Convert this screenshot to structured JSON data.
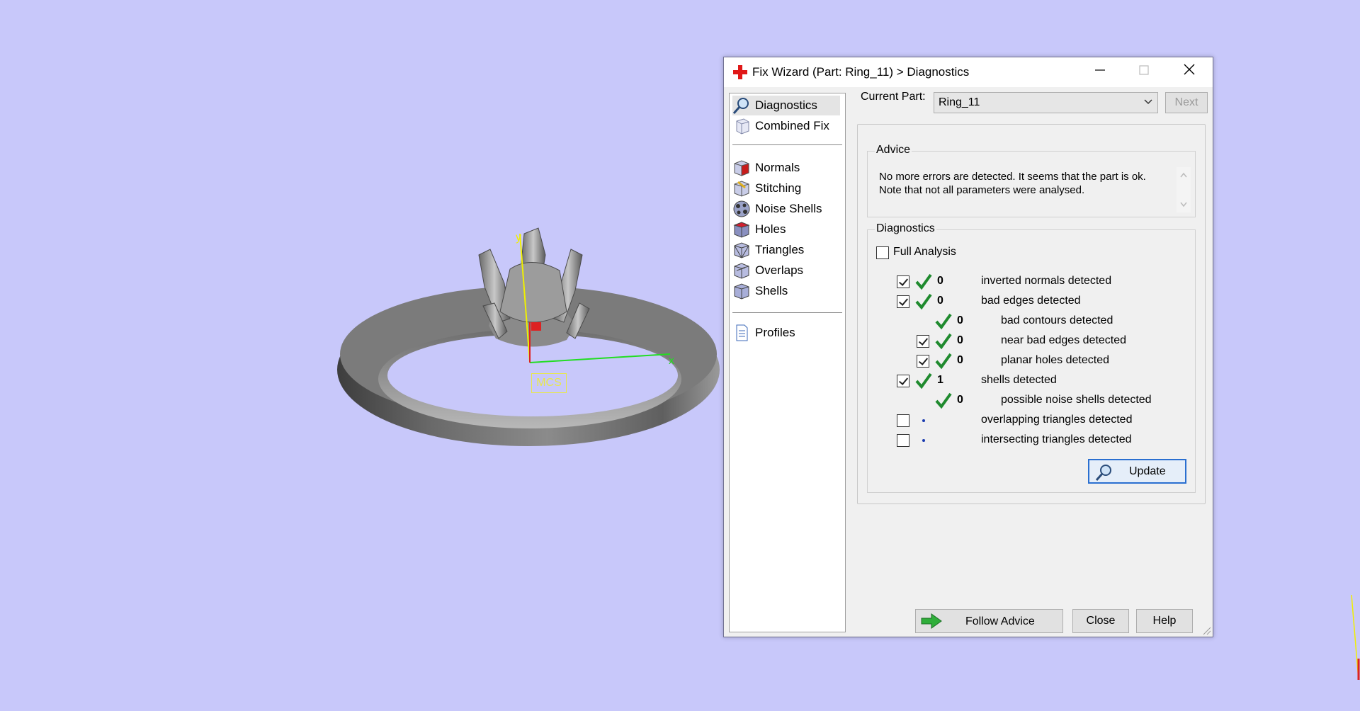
{
  "viewport": {
    "axis_y": "y",
    "axis_x": "x",
    "mcs_label": "MCS"
  },
  "dialog": {
    "title": "Fix Wizard (Part: Ring_11) > Diagnostics",
    "nav": [
      {
        "label": "Diagnostics",
        "icon": "magnifier-icon"
      },
      {
        "label": "Combined Fix",
        "icon": "combined-fix-icon"
      },
      {
        "label": "Normals",
        "icon": "normals-cube-icon"
      },
      {
        "label": "Stitching",
        "icon": "stitching-cube-icon"
      },
      {
        "label": "Noise Shells",
        "icon": "noise-shells-icon"
      },
      {
        "label": "Holes",
        "icon": "holes-cube-icon"
      },
      {
        "label": "Triangles",
        "icon": "triangles-cube-icon"
      },
      {
        "label": "Overlaps",
        "icon": "overlaps-cube-icon"
      },
      {
        "label": "Shells",
        "icon": "shells-cube-icon"
      },
      {
        "label": "Profiles",
        "icon": "document-icon"
      }
    ],
    "current_part_label": "Current Part:",
    "current_part_value": "Ring_11",
    "next_label": "Next",
    "advice": {
      "title": "Advice",
      "line1": "No more errors are detected. It seems that the part is ok.",
      "line2": "Note that not all parameters were analysed."
    },
    "diagnostics": {
      "title": "Diagnostics",
      "full_analysis_label": "Full Analysis",
      "full_analysis_checked": false,
      "rows": [
        {
          "checkbox": true,
          "checked": true,
          "status": "ok",
          "count": "0",
          "label": "inverted normals detected",
          "indent": 0
        },
        {
          "checkbox": true,
          "checked": true,
          "status": "ok",
          "count": "0",
          "label": "bad edges detected",
          "indent": 0
        },
        {
          "checkbox": false,
          "checked": false,
          "status": "ok",
          "count": "0",
          "label": "bad contours detected",
          "indent": 1
        },
        {
          "checkbox": true,
          "checked": true,
          "status": "ok",
          "count": "0",
          "label": "near bad edges detected",
          "indent": 1
        },
        {
          "checkbox": true,
          "checked": true,
          "status": "ok",
          "count": "0",
          "label": "planar holes detected",
          "indent": 1
        },
        {
          "checkbox": true,
          "checked": true,
          "status": "ok",
          "count": "1",
          "label": "shells detected",
          "indent": 0
        },
        {
          "checkbox": false,
          "checked": false,
          "status": "ok",
          "count": "0",
          "label": "possible noise shells detected",
          "indent": 1
        },
        {
          "checkbox": true,
          "checked": false,
          "status": "none",
          "count": "",
          "label": "overlapping triangles detected",
          "indent": 0
        },
        {
          "checkbox": true,
          "checked": false,
          "status": "none",
          "count": "",
          "label": "intersecting triangles detected",
          "indent": 0
        }
      ],
      "update_label": "Update"
    },
    "footer": {
      "follow_advice_label": "Follow Advice",
      "close_label": "Close",
      "help_label": "Help"
    }
  },
  "colors": {
    "background": "#c8c8fa",
    "tick_green": "#1f8a2e",
    "axis_y": "#f0f000",
    "axis_x": "#22dd22"
  }
}
